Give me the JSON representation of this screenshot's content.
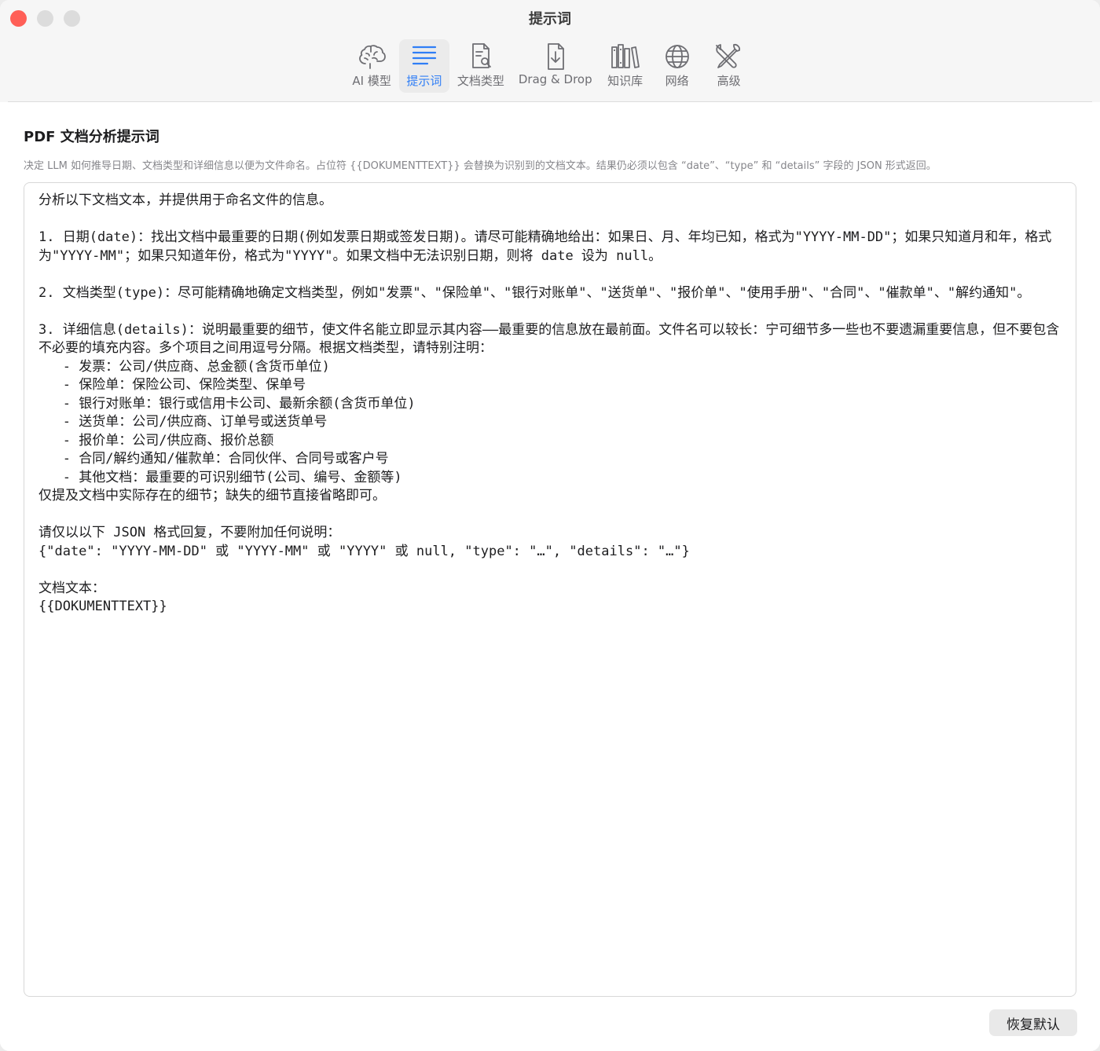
{
  "window": {
    "title": "提示词"
  },
  "toolbar": {
    "tabs": [
      {
        "label": "AI 模型",
        "icon": "brain-icon",
        "active": false
      },
      {
        "label": "提示词",
        "icon": "text-lines-icon",
        "active": true
      },
      {
        "label": "文档类型",
        "icon": "document-search-icon",
        "active": false
      },
      {
        "label": "Drag & Drop",
        "icon": "document-download-icon",
        "active": false
      },
      {
        "label": "知识库",
        "icon": "books-icon",
        "active": false
      },
      {
        "label": "网络",
        "icon": "globe-icon",
        "active": false
      },
      {
        "label": "高级",
        "icon": "tools-icon",
        "active": false
      }
    ]
  },
  "section": {
    "title": "PDF 文档分析提示词",
    "description": "决定 LLM 如何推导日期、文档类型和详细信息以便为文件命名。占位符 {{DOKUMENTTEXT}} 会替换为识别到的文档文本。结果仍必须以包含 “date”、“type” 和 “details” 字段的 JSON 形式返回。"
  },
  "editor": {
    "text": "分析以下文档文本，并提供用于命名文件的信息。\n\n1. 日期(date)：找出文档中最重要的日期(例如发票日期或签发日期)。请尽可能精确地给出：如果日、月、年均已知，格式为\"YYYY-MM-DD\"；如果只知道月和年，格式为\"YYYY-MM\"；如果只知道年份，格式为\"YYYY\"。如果文档中无法识别日期，则将 date 设为 null。\n\n2. 文档类型(type)：尽可能精确地确定文档类型，例如\"发票\"、\"保险单\"、\"银行对账单\"、\"送货单\"、\"报价单\"、\"使用手册\"、\"合同\"、\"催款单\"、\"解约通知\"。\n\n3. 详细信息(details)：说明最重要的细节，使文件名能立即显示其内容——最重要的信息放在最前面。文件名可以较长：宁可细节多一些也不要遗漏重要信息，但不要包含不必要的填充内容。多个项目之间用逗号分隔。根据文档类型，请特别注明：\n   - 发票：公司/供应商、总金额(含货币单位)\n   - 保险单：保险公司、保险类型、保单号\n   - 银行对账单：银行或信用卡公司、最新余额(含货币单位)\n   - 送货单：公司/供应商、订单号或送货单号\n   - 报价单：公司/供应商、报价总额\n   - 合同/解约通知/催款单：合同伙伴、合同号或客户号\n   - 其他文档：最重要的可识别细节(公司、编号、金额等)\n仅提及文档中实际存在的细节；缺失的细节直接省略即可。\n\n请仅以以下 JSON 格式回复，不要附加任何说明：\n{\"date\": \"YYYY-MM-DD\" 或 \"YYYY-MM\" 或 \"YYYY\" 或 null, \"type\": \"…\", \"details\": \"…\"}\n\n文档文本：\n{{DOKUMENTTEXT}}"
  },
  "actions": {
    "reset_label": "恢复默认"
  },
  "colors": {
    "accent": "#2f7ef6",
    "close": "#ff5f57",
    "inactive_light": "#dcdcdc"
  }
}
